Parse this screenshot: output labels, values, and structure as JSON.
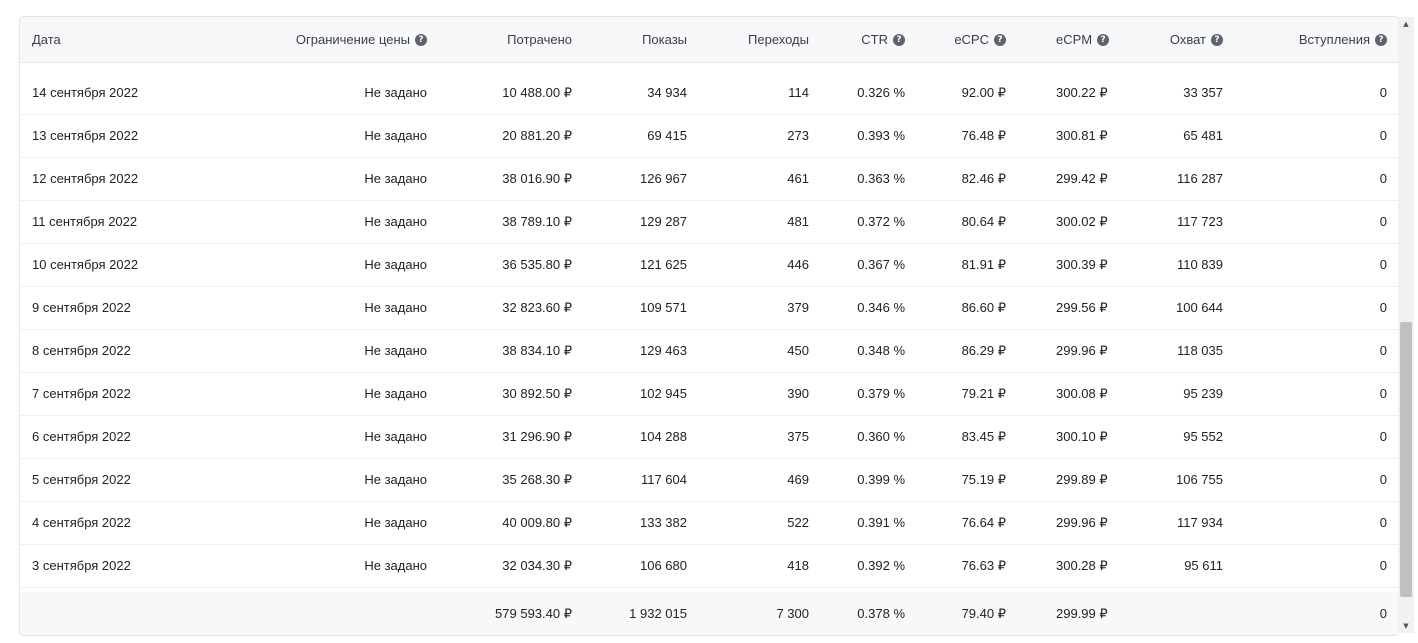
{
  "header": [
    {
      "label": "Дата",
      "help": false
    },
    {
      "label": "Ограничение цены",
      "help": true
    },
    {
      "label": "Потрачено",
      "help": false
    },
    {
      "label": "Показы",
      "help": false
    },
    {
      "label": "Переходы",
      "help": false
    },
    {
      "label": "CTR",
      "help": true
    },
    {
      "label": "eCPC",
      "help": true
    },
    {
      "label": "eCPM",
      "help": true
    },
    {
      "label": "Охват",
      "help": true
    },
    {
      "label": "Вступления",
      "help": true
    }
  ],
  "help_icon_glyph": "?",
  "rows": [
    [
      "14 сентября 2022",
      "Не задано",
      "10 488.00 ₽",
      "34 934",
      "114",
      "0.326 %",
      "92.00 ₽",
      "300.22 ₽",
      "33 357",
      "0"
    ],
    [
      "13 сентября 2022",
      "Не задано",
      "20 881.20 ₽",
      "69 415",
      "273",
      "0.393 %",
      "76.48 ₽",
      "300.81 ₽",
      "65 481",
      "0"
    ],
    [
      "12 сентября 2022",
      "Не задано",
      "38 016.90 ₽",
      "126 967",
      "461",
      "0.363 %",
      "82.46 ₽",
      "299.42 ₽",
      "116 287",
      "0"
    ],
    [
      "11 сентября 2022",
      "Не задано",
      "38 789.10 ₽",
      "129 287",
      "481",
      "0.372 %",
      "80.64 ₽",
      "300.02 ₽",
      "117 723",
      "0"
    ],
    [
      "10 сентября 2022",
      "Не задано",
      "36 535.80 ₽",
      "121 625",
      "446",
      "0.367 %",
      "81.91 ₽",
      "300.39 ₽",
      "110 839",
      "0"
    ],
    [
      "9 сентября 2022",
      "Не задано",
      "32 823.60 ₽",
      "109 571",
      "379",
      "0.346 %",
      "86.60 ₽",
      "299.56 ₽",
      "100 644",
      "0"
    ],
    [
      "8 сентября 2022",
      "Не задано",
      "38 834.10 ₽",
      "129 463",
      "450",
      "0.348 %",
      "86.29 ₽",
      "299.96 ₽",
      "118 035",
      "0"
    ],
    [
      "7 сентября 2022",
      "Не задано",
      "30 892.50 ₽",
      "102 945",
      "390",
      "0.379 %",
      "79.21 ₽",
      "300.08 ₽",
      "95 239",
      "0"
    ],
    [
      "6 сентября 2022",
      "Не задано",
      "31 296.90 ₽",
      "104 288",
      "375",
      "0.360 %",
      "83.45 ₽",
      "300.10 ₽",
      "95 552",
      "0"
    ],
    [
      "5 сентября 2022",
      "Не задано",
      "35 268.30 ₽",
      "117 604",
      "469",
      "0.399 %",
      "75.19 ₽",
      "299.89 ₽",
      "106 755",
      "0"
    ],
    [
      "4 сентября 2022",
      "Не задано",
      "40 009.80 ₽",
      "133 382",
      "522",
      "0.391 %",
      "76.64 ₽",
      "299.96 ₽",
      "117 934",
      "0"
    ],
    [
      "3 сентября 2022",
      "Не задано",
      "32 034.30 ₽",
      "106 680",
      "418",
      "0.392 %",
      "76.63 ₽",
      "300.28 ₽",
      "95 611",
      "0"
    ]
  ],
  "totals": [
    "",
    "",
    "579 593.40 ₽",
    "1 932 015",
    "7 300",
    "0.378 %",
    "79.40 ₽",
    "299.99 ₽",
    "",
    "0"
  ],
  "scroll": {
    "up_glyph": "▲",
    "down_glyph": "▼"
  }
}
